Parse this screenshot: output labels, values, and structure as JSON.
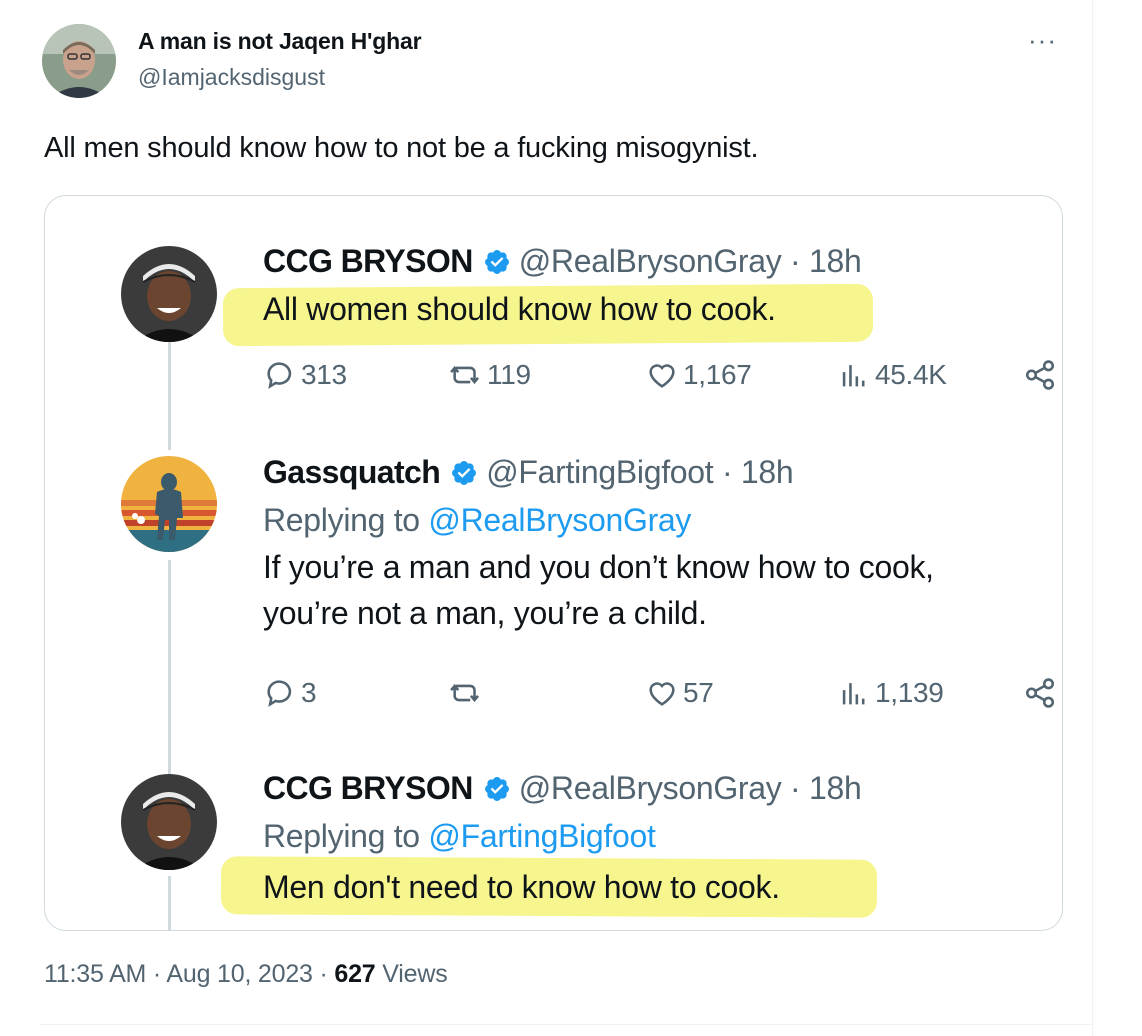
{
  "main_tweet": {
    "author_name": "A man is not Jaqen H'ghar",
    "author_handle": "@Iamjacksdisgust",
    "more_label": "···",
    "text": "All men should know how to not be a fucking misogynist.",
    "timestamp": "11:35 AM · Aug 10, 2023",
    "separator": " · ",
    "views_count": "627",
    "views_label": " Views"
  },
  "quoted_thread": [
    {
      "name": "CCG BRYSON",
      "meta": "@RealBrysonGray · 18h",
      "replying_label": "",
      "replying_to": "",
      "text": "All women should know how to cook.",
      "highlighted": true,
      "stats": {
        "replies": "313",
        "retweets": "119",
        "likes": "1,167",
        "views": "45.4K"
      }
    },
    {
      "name": "Gassquatch",
      "meta": "@FartingBigfoot · 18h",
      "replying_label": "Replying to ",
      "replying_to": "@RealBrysonGray",
      "text_line1": "If you’re a man and you don’t know how to cook,",
      "text_line2": "you’re not a man, you’re a child.",
      "highlighted": false,
      "stats": {
        "replies": "3",
        "retweets": "",
        "likes": "57",
        "views": "1,139"
      }
    },
    {
      "name": "CCG BRYSON",
      "meta": "@RealBrysonGray · 18h",
      "replying_label": "Replying to ",
      "replying_to": "@FartingBigfoot",
      "text": "Men don't need to know how to cook.",
      "highlighted": true
    }
  ],
  "colors": {
    "text": "#0f1419",
    "secondary": "#536471",
    "link": "#1d9bf0",
    "verified": "#1d9bf0",
    "highlight": "#f5f37a",
    "border": "#cfd9de"
  },
  "icons": [
    "more-icon",
    "verified-badge-icon",
    "reply-icon",
    "retweet-icon",
    "like-icon",
    "views-icon",
    "share-icon"
  ]
}
